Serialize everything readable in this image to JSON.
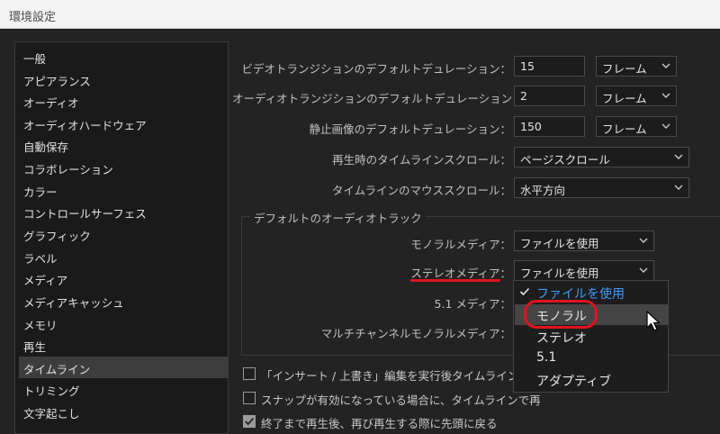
{
  "window": {
    "title": "環境設定"
  },
  "sidebar": {
    "items": [
      "一般",
      "アピアランス",
      "オーディオ",
      "オーディオハードウェア",
      "自動保存",
      "コラボレーション",
      "カラー",
      "コントロールサーフェス",
      "グラフィック",
      "ラベル",
      "メディア",
      "メディアキャッシュ",
      "メモリ",
      "再生",
      "タイムライン",
      "トリミング",
      "文字起こし"
    ],
    "selected_index": 14
  },
  "settings": {
    "video_transition": {
      "label": "ビデオトランジションのデフォルトデュレーション：",
      "value": "15",
      "unit": "フレーム"
    },
    "audio_transition": {
      "label": "オーディオトランジションのデフォルトデュレーション：",
      "value": "2",
      "unit": "フレーム"
    },
    "still_image": {
      "label": "静止画像のデフォルトデュレーション：",
      "value": "150",
      "unit": "フレーム"
    },
    "playback_scroll": {
      "label": "再生時のタイムラインスクロール：",
      "value": "ページスクロール"
    },
    "mouse_scroll": {
      "label": "タイムラインのマウススクロール：",
      "value": "水平方向"
    }
  },
  "audio_tracks": {
    "group_title": "デフォルトのオーディオトラック",
    "mono": {
      "label": "モノラルメディア：",
      "value": "ファイルを使用"
    },
    "stereo": {
      "label": "ステレオメディア：",
      "value": "ファイルを使用"
    },
    "five_one": {
      "label": "5.1 メディア："
    },
    "multichannel": {
      "label": "マルチチャンネルモノラルメディア："
    }
  },
  "dropdown_popup": {
    "options": [
      "ファイルを使用",
      "モノラル",
      "ステレオ",
      "5.1",
      "アダプティブ"
    ],
    "selected_index": 0,
    "hover_index": 1
  },
  "checkboxes": [
    {
      "label": "「インサート / 上書き」編集を実行後タイムラインにフ",
      "checked": false
    },
    {
      "label": "スナップが有効になっている場合に、タイムラインで再",
      "checked": false
    },
    {
      "label": "終了まで再生後、再び再生する際に先頭に戻る",
      "checked": true
    }
  ],
  "colors": {
    "accent_blue": "#3d9bff",
    "annotation_red": "#e0141e"
  }
}
